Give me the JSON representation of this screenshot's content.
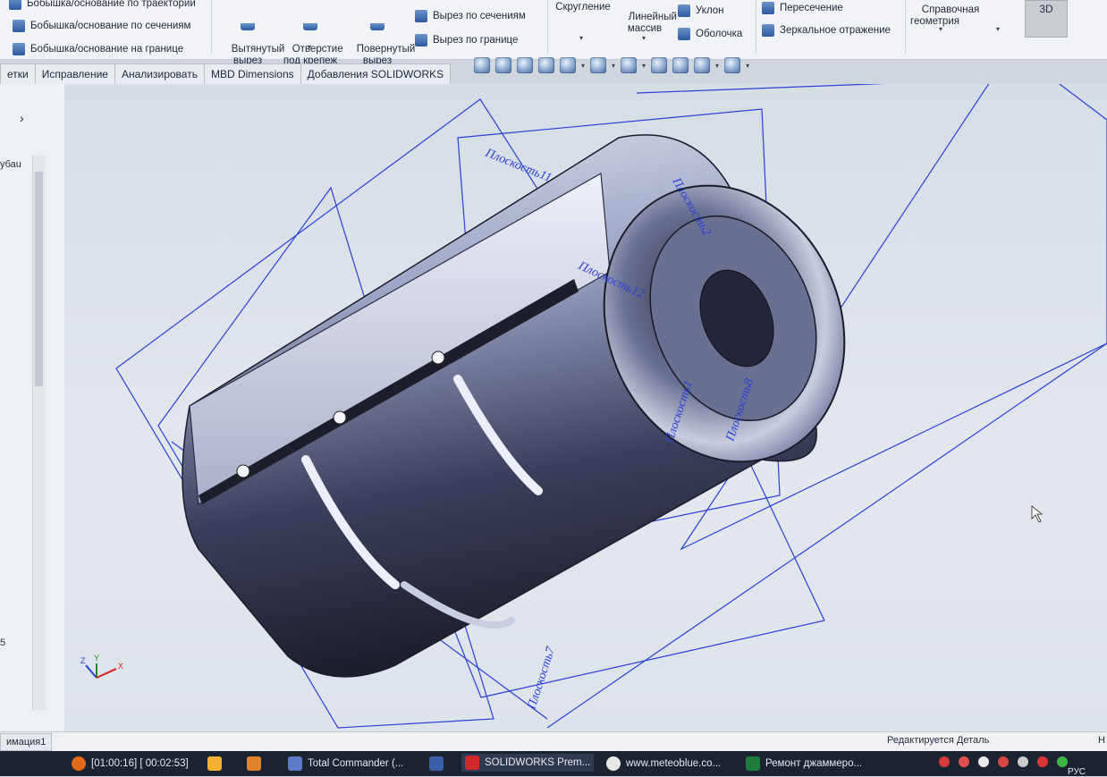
{
  "ribbon": {
    "features": [
      "Бобышка/основание по траектории",
      "Бобышка/основание по сечениям",
      "Бобышка/основание на границе"
    ],
    "extruded_cut": "Вытянутый\nвырез",
    "hole_wizard": "Отверстие\nпод крепеж",
    "revolved_cut": "Повернутый\nвырез",
    "lofted_cut": "Вырез по сечениям",
    "boundary_cut": "Вырез по границе",
    "fillet": "Скругление",
    "linear_pattern": "Линейный\nмассив",
    "draft": "Уклон",
    "shell": "Оболочка",
    "intersect": "Пересечение",
    "mirror": "Зеркальное отражение",
    "ref_geometry": "Справочная\nгеометрия",
    "btn_3d": "3D"
  },
  "tabs": [
    "етки",
    "Исправление",
    "Анализировать",
    "MBD Dimensions",
    "Добавления SOLIDWORKS"
  ],
  "left_panel": {
    "collapse": "›",
    "tree_label": "убаu",
    "bottom_number": "5"
  },
  "viewport": {
    "plane_labels": [
      "Плоскость11",
      "Плоскость2",
      "Плоскость12",
      "Плоскость1",
      "Плоскость8",
      "Плоскость7"
    ],
    "triad": {
      "x": "X",
      "y": "Y",
      "z": "Z"
    }
  },
  "status": {
    "tree_tab": "имация1",
    "text": "Редактируется Деталь",
    "right": "Н"
  },
  "taskbar": {
    "items": [
      "[01:00:16] [ 00:02:53]",
      "Total Commander (...",
      "SOLIDWORKS Prem...",
      "www.meteoblue.co...",
      "Ремонт джаммеро..."
    ],
    "language": "РУС"
  },
  "colors": {
    "plane": "#2b3fd8",
    "viewport_bg": "#dde3ea",
    "ribbon_bg": "#f1f3f6"
  }
}
